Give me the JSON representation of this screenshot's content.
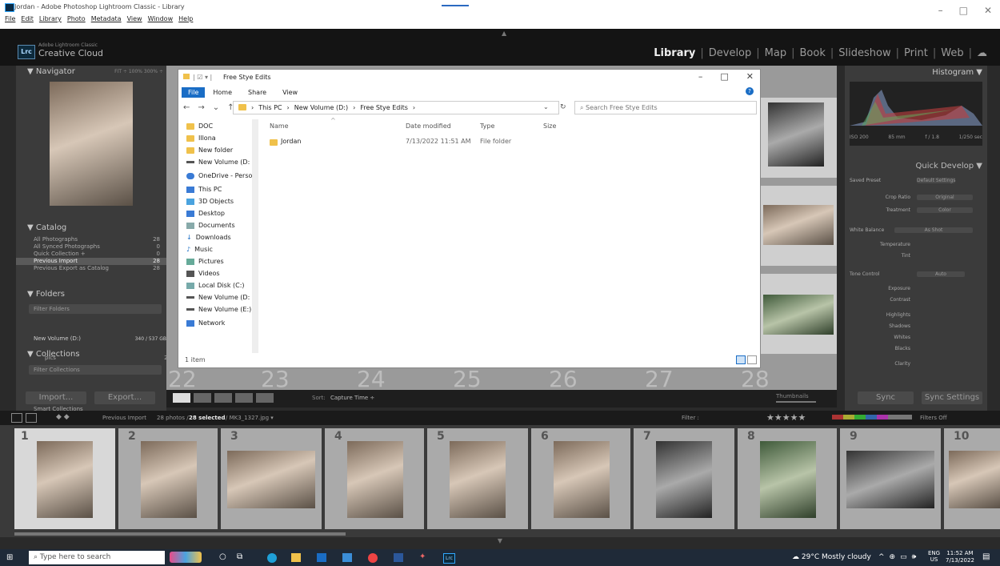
{
  "window": {
    "title": "Jordan - Adobe Photoshop Lightroom Classic - Library",
    "menu": [
      "File",
      "Edit",
      "Library",
      "Photo",
      "Metadata",
      "View",
      "Window",
      "Help"
    ],
    "controls": [
      "–",
      "□",
      "✕"
    ]
  },
  "identity": {
    "small": "Adobe Lightroom Classic",
    "big": "Creative Cloud",
    "logo": "Lrc"
  },
  "modules": [
    {
      "label": "Library",
      "active": true
    },
    {
      "label": "Develop"
    },
    {
      "label": "Map"
    },
    {
      "label": "Book"
    },
    {
      "label": "Slideshow"
    },
    {
      "label": "Print"
    },
    {
      "label": "Web"
    }
  ],
  "left": {
    "navigator": {
      "title": "Navigator",
      "opts": "FIT ÷ 100% 300% ÷"
    },
    "catalog": {
      "title": "Catalog",
      "items": [
        {
          "label": "All Photographs",
          "count": "28"
        },
        {
          "label": "All Synced Photographs",
          "count": "0"
        },
        {
          "label": "Quick Collection +",
          "count": "0"
        },
        {
          "label": "Previous Import",
          "count": "28"
        },
        {
          "label": "Previous Export as Catalog",
          "count": "28"
        }
      ]
    },
    "folders": {
      "title": "Folders",
      "filter": "Filter Folders",
      "volume": "New Volume (D:)",
      "volume_size": "340 / 537 GB",
      "sub": "pics",
      "sub_count": "28"
    },
    "collections": {
      "title": "Collections",
      "filter": "Filter Collections",
      "smart": "Smart Collections"
    },
    "import": "Import...",
    "export": "Export..."
  },
  "right": {
    "histogram": {
      "title": "Histogram",
      "iso": "ISO 200",
      "focal": "85 mm",
      "aperture": "f / 1.8",
      "shutter": "1/250 sec"
    },
    "quick_develop": {
      "title": "Quick Develop",
      "saved_preset": "Saved Preset",
      "preset_value": "Default Settings",
      "crop": "Crop Ratio",
      "crop_value": "Original",
      "treatment": "Treatment",
      "treatment_value": "Color",
      "wb": "White Balance",
      "wb_value": "As Shot",
      "temp": "Temperature",
      "tint": "Tint",
      "tone": "Tone Control",
      "auto": "Auto",
      "exposure": "Exposure",
      "contrast": "Contrast",
      "highlights": "Highlights",
      "shadows": "Shadows",
      "whites": "Whites",
      "blacks": "Blacks",
      "clarity": "Clarity"
    },
    "sync": "Sync",
    "sync_settings": "Sync Settings"
  },
  "grid": {
    "bottom_numbers": [
      "22",
      "23",
      "24",
      "25",
      "26",
      "27",
      "28"
    ],
    "toolbar_sort": "Sort:",
    "sort_value": "Capture Time ÷",
    "thumbnails": "Thumbnails"
  },
  "filmstrip": {
    "source": "Previous Import",
    "info": "28 photos /",
    "selected": "28 selected",
    "file": "/ MK3_1327.jpg ▾",
    "filter": "Filter :",
    "filters_off": "Filters Off",
    "numbers": [
      "1",
      "2",
      "3",
      "4",
      "5",
      "6",
      "7",
      "8",
      "9",
      "10"
    ]
  },
  "explorer": {
    "title": "Free Stye Edits",
    "tabs": [
      "File",
      "Home",
      "Share",
      "View"
    ],
    "path": [
      "This PC",
      "New Volume (D:)",
      "Free Stye Edits"
    ],
    "search": "Search Free Stye Edits",
    "nav": [
      "DOC",
      "Illona",
      "New folder",
      "New Volume (D:",
      "OneDrive - Person",
      "This PC",
      "3D Objects",
      "Desktop",
      "Documents",
      "Downloads",
      "Music",
      "Pictures",
      "Videos",
      "Local Disk (C:)",
      "New Volume (D:",
      "New Volume (E:)",
      "Network"
    ],
    "columns": [
      "Name",
      "Date modified",
      "Type",
      "Size"
    ],
    "rows": [
      {
        "name": "Jordan",
        "date": "7/13/2022 11:51 AM",
        "type": "File folder",
        "size": ""
      }
    ],
    "status": "1 item"
  },
  "taskbar": {
    "search": "Type here to search",
    "weather": "29°C Mostly cloudy",
    "lang": "ENG",
    "region": "US",
    "time": "11:52 AM",
    "date": "7/13/2022"
  }
}
